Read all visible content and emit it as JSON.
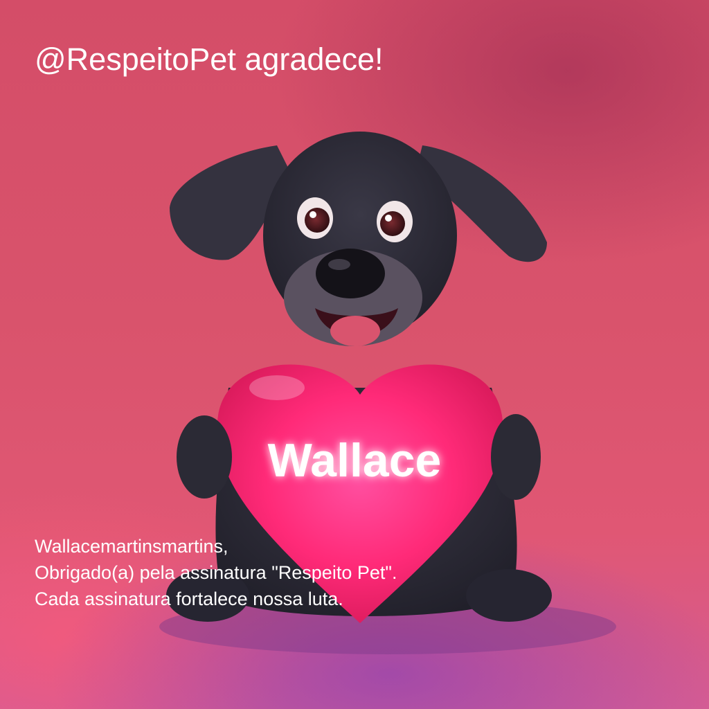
{
  "headline": "@RespeitoPet agradece!",
  "heart": {
    "name": "Wallace"
  },
  "message": {
    "lines": [
      "Wallacemartinsmartins,",
      "Obrigado(a) pela assinatura \"Respeito Pet\".",
      "Cada assinatura fortalece nossa luta."
    ]
  },
  "colors": {
    "background": "#d9536c",
    "heart": "#ff2a78",
    "dog_fur": "#2c2a36",
    "text": "#ffffff"
  }
}
